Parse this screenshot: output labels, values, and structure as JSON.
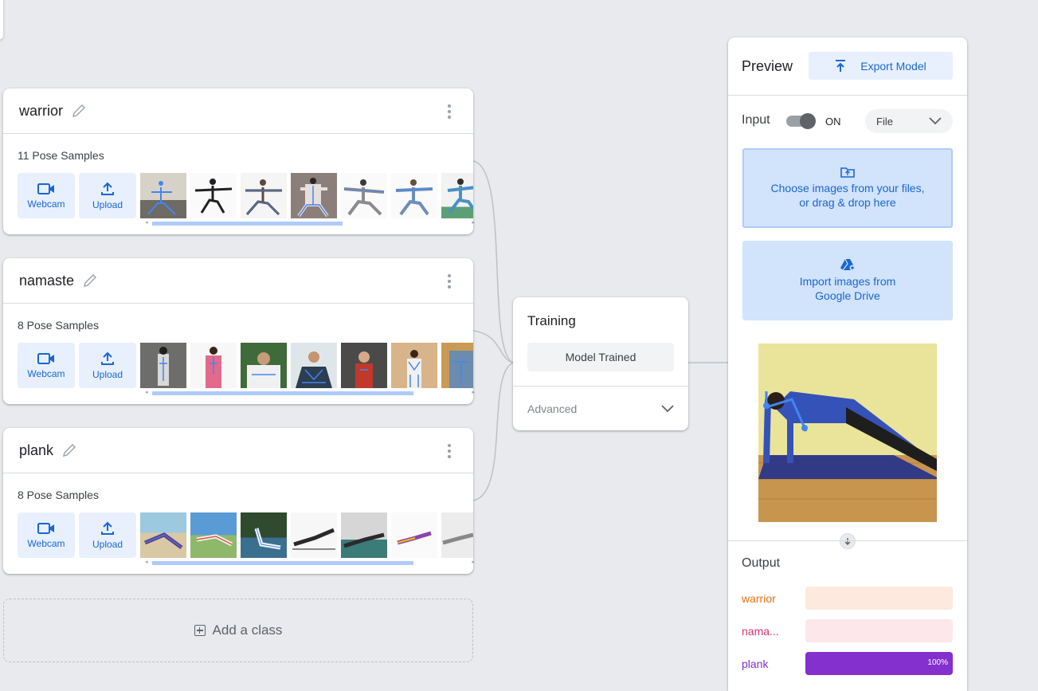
{
  "classes": [
    {
      "name": "warrior",
      "samples": "11 Pose Samples",
      "webcam_label": "Webcam",
      "upload_label": "Upload"
    },
    {
      "name": "namaste",
      "samples": "8 Pose Samples",
      "webcam_label": "Webcam",
      "upload_label": "Upload"
    },
    {
      "name": "plank",
      "samples": "8 Pose Samples",
      "webcam_label": "Webcam",
      "upload_label": "Upload"
    }
  ],
  "add_class_label": "Add a class",
  "training": {
    "title": "Training",
    "button_label": "Model Trained",
    "advanced_label": "Advanced"
  },
  "preview": {
    "title": "Preview",
    "export_label": "Export Model",
    "input_label": "Input",
    "toggle_state": "ON",
    "input_source": "File",
    "drop_line1": "Choose images from your files,",
    "drop_line2": "or drag & drop here",
    "drive_line1": "Import images from",
    "drive_line2": "Google Drive",
    "output_label": "Output",
    "outputs": [
      {
        "name": "warrior",
        "color": "#e8710a",
        "track": "#fde9dd",
        "fraction": 0.0,
        "pct": ""
      },
      {
        "name": "nama...",
        "color": "#d93474",
        "track": "#fde7ea",
        "fraction": 0.0,
        "pct": ""
      },
      {
        "name": "plank",
        "color": "#8430ce",
        "track": "#f3e8fd",
        "fraction": 1.0,
        "pct": "100%"
      }
    ]
  },
  "colors": {
    "accent_blue": "#1967d2",
    "button_bg": "#e8f0fe",
    "skeleton": "#4285f4"
  }
}
